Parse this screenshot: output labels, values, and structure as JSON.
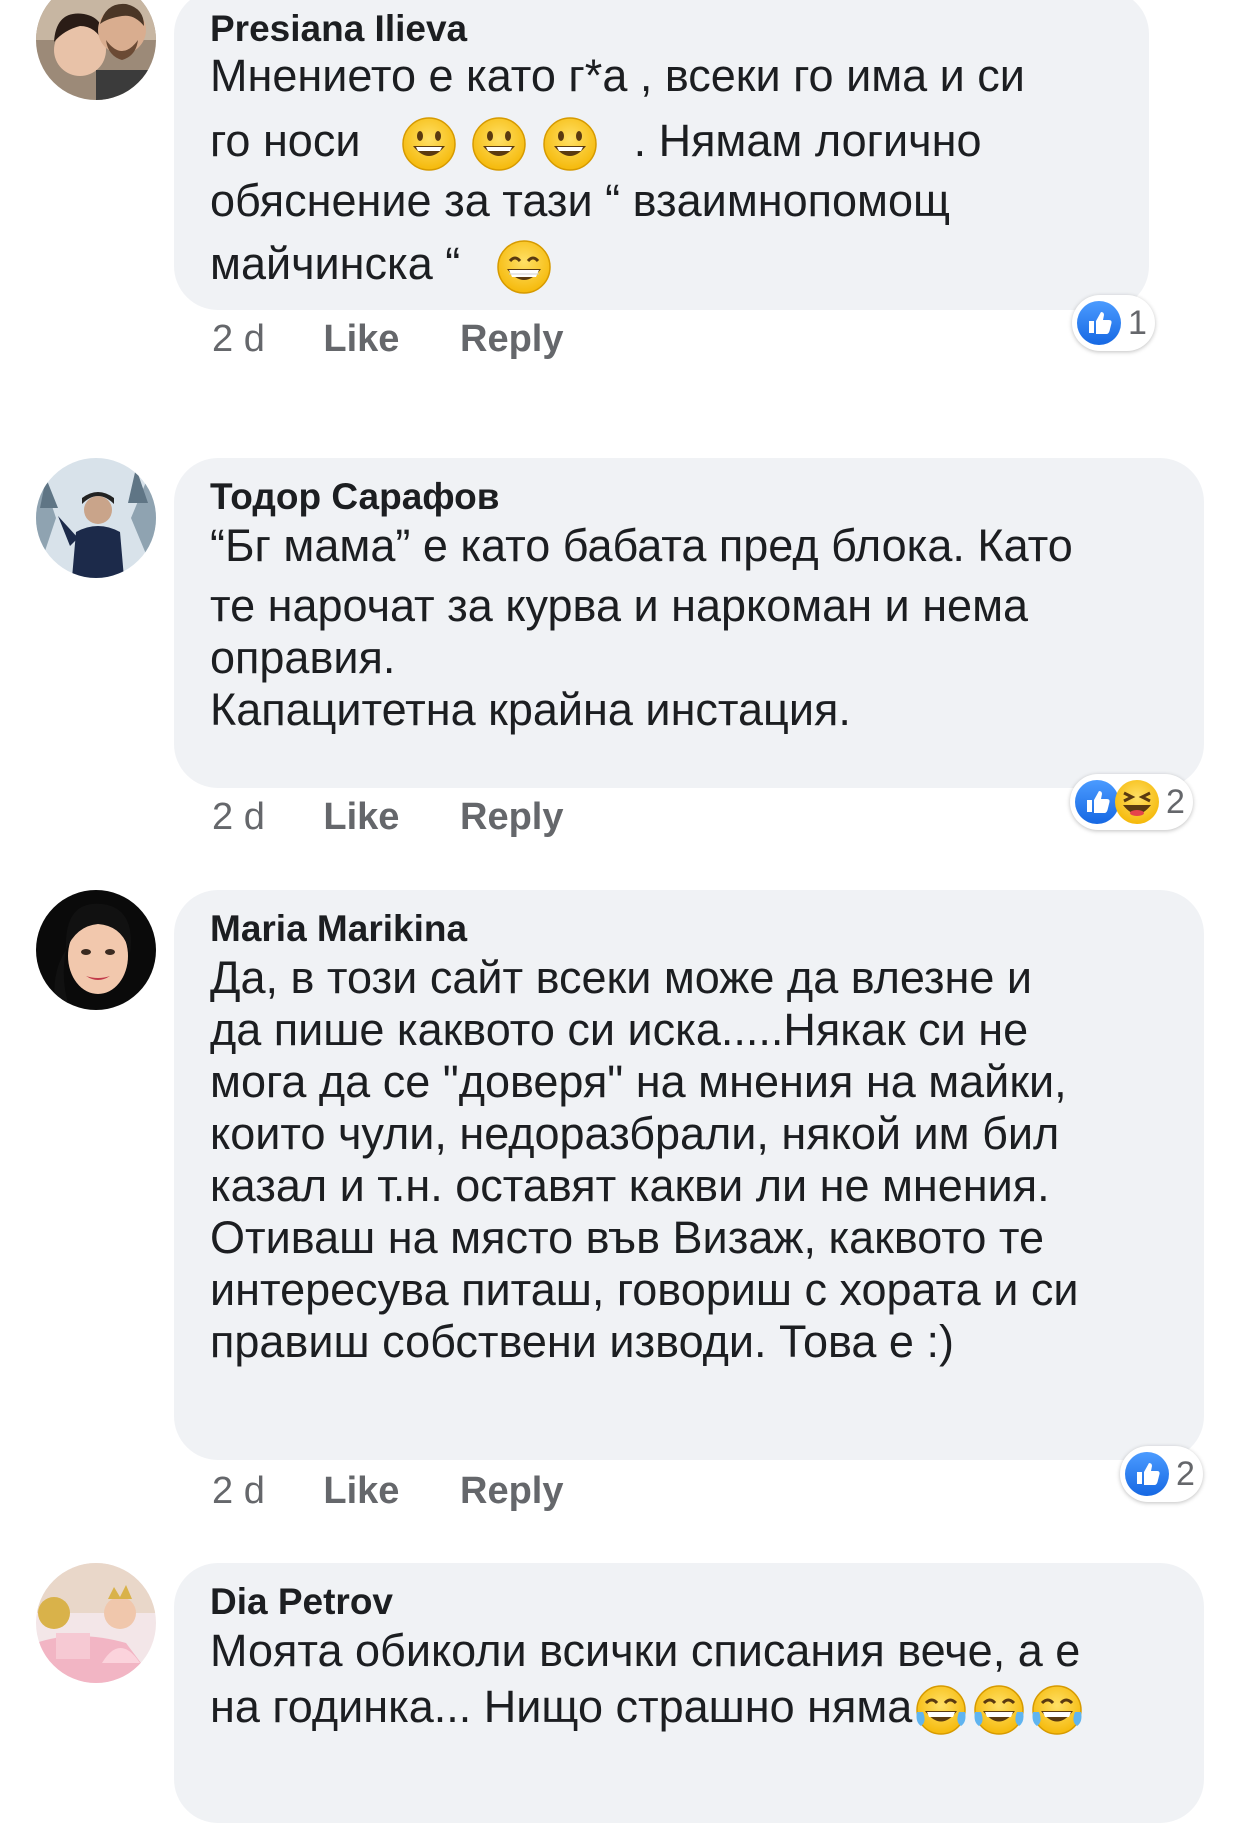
{
  "comments": [
    {
      "author": "Presiana Ilieva",
      "lines": [
        "Мнението е като г*а , всеки го има и си",
        "го носи",
        ". Нямам логично",
        "обяснение за тази “ взаимнопомощ",
        "майчинска “"
      ],
      "time": "2 d",
      "like": "Like",
      "reply": "Reply",
      "reaction_count": "1"
    },
    {
      "author": "Тодор Сарафов",
      "lines": [
        "“Бг мама” е като бабата пред блока. Като",
        "те нарочат за курва и наркоман и нема",
        "оправия.",
        "Капацитетна крайна инстация."
      ],
      "time": "2 d",
      "like": "Like",
      "reply": "Reply",
      "reaction_count": "2"
    },
    {
      "author": "Maria Marikina",
      "lines": [
        "Да, в този сайт всеки може да влезне и",
        "да пише каквото си иска.....Някак си не",
        "мога да се \"доверя\" на мнения на майки,",
        "които чули, недоразбрали, някой им бил",
        "казал и т.н. оставят какви ли не мнения.",
        "Отиваш на място във Визаж,  каквото те",
        "интересува питаш, говориш с хората и си",
        "правиш собствени изводи. Това е :)"
      ],
      "time": "2 d",
      "like": "Like",
      "reply": "Reply",
      "reaction_count": "2"
    },
    {
      "author": "Dia Petrov",
      "lines": [
        "Моята обиколи всички списания вече, а е",
        "на годинка... Нищо страшно няма"
      ]
    }
  ],
  "colors": {
    "bubble": "#f0f2f5",
    "text": "#1c1e21",
    "secondary": "#65676b",
    "like_blue": "#1877f2"
  },
  "icons": [
    "grinning-emoji",
    "beaming-emoji",
    "laughing-squint-emoji",
    "tears-of-joy-emoji",
    "like-reaction-icon",
    "haha-reaction-icon"
  ]
}
